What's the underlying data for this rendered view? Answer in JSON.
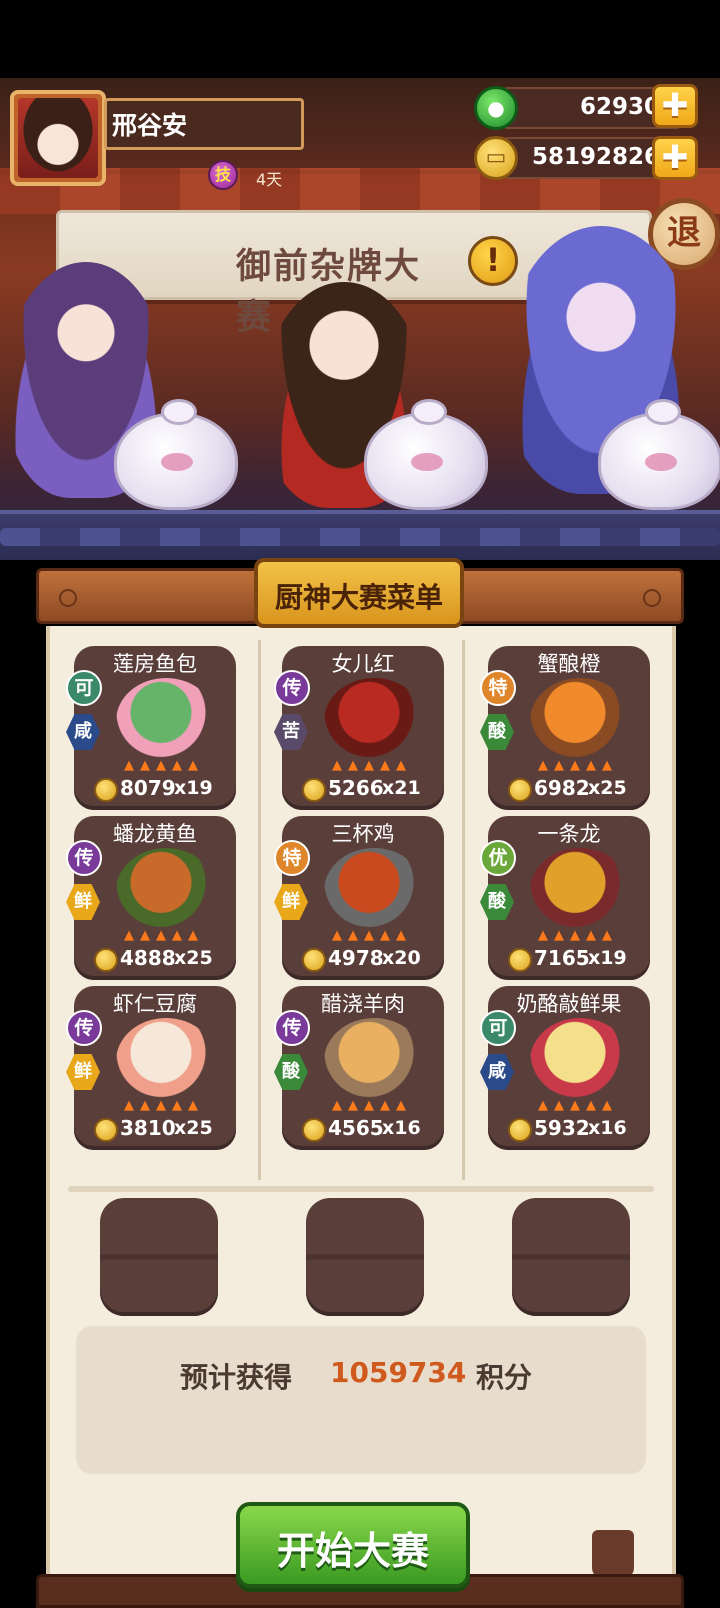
{
  "player": {
    "name": "邢谷安",
    "skill_icon_glyph": "技",
    "days": "4天"
  },
  "currencies": {
    "jade": {
      "icon": "jade-icon",
      "value": "62930"
    },
    "coins": {
      "icon": "coin-icon",
      "value": "58192826"
    },
    "plus_glyph": "✚"
  },
  "event": {
    "banner_title": "御前杂牌大赛",
    "alert_glyph": "!",
    "exit_label": "退"
  },
  "menu": {
    "title": "厨神大赛菜单",
    "dishes": [
      {
        "name": "莲房鱼包",
        "rank": "可",
        "taste": "咸",
        "price": "8079",
        "qty": "x19",
        "colors": [
          "#66b36a",
          "#f0a0b8"
        ]
      },
      {
        "name": "女儿红",
        "rank": "传",
        "taste": "苦",
        "price": "5266",
        "qty": "x21",
        "colors": [
          "#b82a22",
          "#6a1a14"
        ]
      },
      {
        "name": "蟹酿橙",
        "rank": "特",
        "taste": "酸",
        "price": "6982",
        "qty": "x25",
        "colors": [
          "#f08a2a",
          "#8a4a22"
        ]
      },
      {
        "name": "蟠龙黄鱼",
        "rank": "传",
        "taste": "鲜",
        "price": "4888",
        "qty": "x25",
        "colors": [
          "#c86a2a",
          "#4a6a2a"
        ]
      },
      {
        "name": "三杯鸡",
        "rank": "特",
        "taste": "鲜",
        "price": "4978",
        "qty": "x20",
        "colors": [
          "#c84a1e",
          "#6a6a6a"
        ]
      },
      {
        "name": "一条龙",
        "rank": "优",
        "taste": "酸",
        "price": "7165",
        "qty": "x19",
        "colors": [
          "#e0a02a",
          "#7a2a2a"
        ]
      },
      {
        "name": "虾仁豆腐",
        "rank": "传",
        "taste": "鲜",
        "price": "3810",
        "qty": "x25",
        "colors": [
          "#f6e8d8",
          "#f0a08a"
        ]
      },
      {
        "name": "醋浇羊肉",
        "rank": "传",
        "taste": "酸",
        "price": "4565",
        "qty": "x16",
        "colors": [
          "#e8b060",
          "#9a7a5a"
        ]
      },
      {
        "name": "奶酪敲鲜果",
        "rank": "可",
        "taste": "咸",
        "price": "5932",
        "qty": "x16",
        "colors": [
          "#f4e08a",
          "#c83a4a"
        ]
      }
    ],
    "empty_slots": 3
  },
  "estimate": {
    "label": "预计获得",
    "value": "1059734",
    "unit": "积分"
  },
  "start_button": "开始大赛",
  "colors": {
    "rank": {
      "可": "#3a8a6a",
      "传": "#7a3a9a",
      "特": "#e0862a",
      "优": "#6aa83a"
    },
    "taste": {
      "咸": "#2a4a8a",
      "苦": "#5a4a6a",
      "酸": "#3a8a3a",
      "鲜": "#e8a81a"
    },
    "start": "#3a9a22",
    "estimate_value": "#d05a1e"
  }
}
